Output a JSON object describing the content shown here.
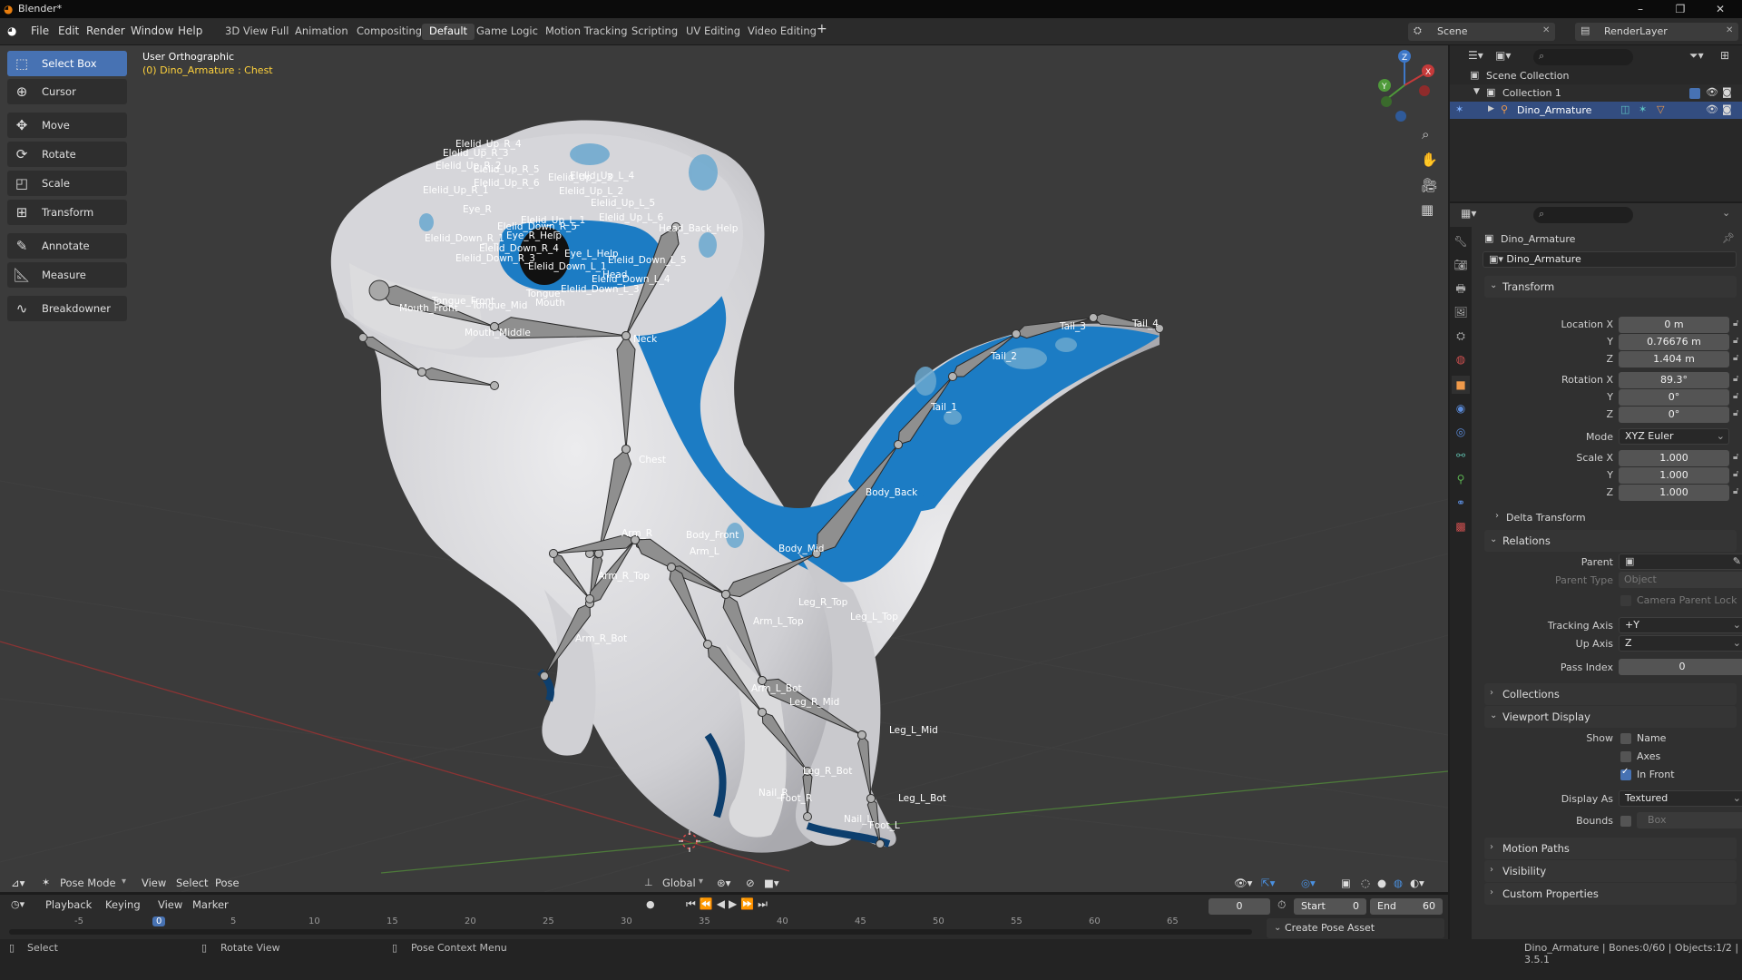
{
  "titlebar": {
    "title": "Blender*"
  },
  "menu": [
    "File",
    "Edit",
    "Render",
    "Window",
    "Help"
  ],
  "workspaces": [
    "3D View Full",
    "Animation",
    "Compositing",
    "Default",
    "Game Logic",
    "Motion Tracking",
    "Scripting",
    "UV Editing",
    "Video Editing"
  ],
  "active_workspace": "Default",
  "scene": {
    "scene_name": "Scene",
    "view_layer": "RenderLayer"
  },
  "toolbar": [
    "Select Box",
    "Cursor",
    "Move",
    "Rotate",
    "Scale",
    "Transform",
    "Annotate",
    "Measure",
    "Breakdowner"
  ],
  "viewport": {
    "view_name": "User Orthographic",
    "context": "(0) Dino_Armature : Chest",
    "bones": [
      "Elelid_Up_R_4",
      "Elelid_Up_R_3",
      "Elelid_Up_R_2",
      "Elelid_Up_R_5",
      "Elelid_Up_R_6",
      "Elelid_Up_R_1",
      "Elelid_Up_L_4",
      "Elelid_Up_L_3",
      "Elelid_Up_L_2",
      "Elelid_Up_L_5",
      "Elelid_Up_L_6",
      "Eye_R",
      "Eye_R_Help",
      "Elelid_Up_L_1",
      "Head_Back_Help",
      "Elelid_Down_R_1",
      "Elelid_Down_R_5",
      "Elelid_Down_R_4",
      "Elelid_Down_R_3",
      "Elelid_Down_L_1",
      "Eye_L_Help",
      "Elelid_Down_L_5",
      "Elelid_Down_L_4",
      "Elelid_Down_L_3",
      "Head",
      "Tongue_Front",
      "Tongue_Mid",
      "Tongue",
      "Mouth_Front",
      "Mouth",
      "Mouth_Middle",
      "Neck",
      "Chest",
      "Tail_1",
      "Tail_2",
      "Tail_3",
      "Tail_4",
      "Body_Back",
      "Arm_R",
      "Body_Front",
      "Arm_L",
      "Body_Mid",
      "Arm_R_Top",
      "Leg_R_Top",
      "Arm_L_Top",
      "Leg_L_Top",
      "Arm_R_Bot",
      "Arm_L_Bot",
      "Leg_R_Mid",
      "Leg_L_Mid",
      "Leg_R_Bot",
      "Leg_L_Bot",
      "Nail_R",
      "Foot_R",
      "Nail_L",
      "Foot_L"
    ]
  },
  "viewport_header": {
    "mode": "Pose Mode",
    "menus": [
      "View",
      "Select",
      "Pose"
    ],
    "orientation": "Global"
  },
  "timeline": {
    "menus": [
      "Playback",
      "Keying",
      "View",
      "Marker"
    ],
    "current_frame": "0",
    "start_label": "Start",
    "start": "0",
    "end_label": "End",
    "end": "60",
    "ticks": [
      "-5",
      "0",
      "5",
      "10",
      "15",
      "20",
      "25",
      "30",
      "35",
      "40",
      "45",
      "50",
      "55",
      "60",
      "65"
    ],
    "asset_button": "Create Pose Asset"
  },
  "statusbar": {
    "select": "Select",
    "rotate": "Rotate View",
    "context": "Pose Context Menu",
    "info": "Dino_Armature | Bones:0/60 | Objects:1/2 | 3.5.1"
  },
  "outliner": {
    "scene_collection": "Scene Collection",
    "collection": "Collection 1",
    "object": "Dino_Armature"
  },
  "properties": {
    "object_name": "Dino_Armature",
    "data_name": "Dino_Armature",
    "transform": {
      "title": "Transform",
      "location_label": "Location X",
      "loc_x": "0 m",
      "loc_y": "0.76676 m",
      "loc_z": "1.404 m",
      "rotation_label": "Rotation X",
      "rot_x": "89.3°",
      "rot_y": "0°",
      "rot_z": "0°",
      "mode_label": "Mode",
      "mode": "XYZ Euler",
      "scale_label": "Scale X",
      "scale_x": "1.000",
      "scale_y": "1.000",
      "scale_z": "1.000",
      "y": "Y",
      "z": "Z"
    },
    "delta_transform": "Delta Transform",
    "relations": {
      "title": "Relations",
      "parent_label": "Parent",
      "parent_type_label": "Parent Type",
      "parent_type": "Object",
      "camera_parent_lock": "Camera Parent Lock",
      "tracking_axis_label": "Tracking Axis",
      "tracking_axis": "+Y",
      "up_axis_label": "Up Axis",
      "up_axis": "Z",
      "pass_index_label": "Pass Index",
      "pass_index": "0"
    },
    "collections": "Collections",
    "viewport_display": {
      "title": "Viewport Display",
      "show_label": "Show",
      "name": "Name",
      "axes": "Axes",
      "in_front": "In Front",
      "display_as_label": "Display As",
      "display_as": "Textured",
      "bounds_label": "Bounds",
      "bounds": "Box"
    },
    "motion_paths": "Motion Paths",
    "visibility": "Visibility",
    "custom_properties": "Custom Properties"
  },
  "colors": {
    "accent": "#4772b3",
    "context_text": "#ffd23c",
    "dino_blue": "#1c7cc4",
    "dino_body": "#d8d8da"
  }
}
